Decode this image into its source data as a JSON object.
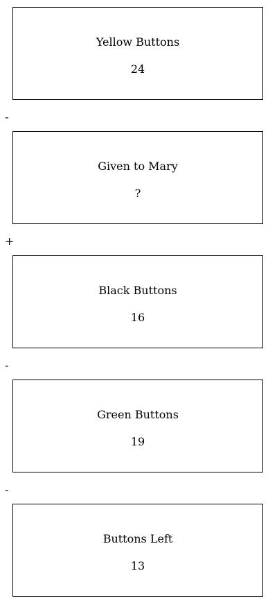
{
  "steps": [
    {
      "label": "Yellow Buttons",
      "value": "24"
    },
    {
      "label": "Given to Mary",
      "value": "?"
    },
    {
      "label": "Black Buttons",
      "value": "16"
    },
    {
      "label": "Green Buttons",
      "value": "19"
    },
    {
      "label": "Buttons Left",
      "value": "13"
    }
  ],
  "operators": [
    "-",
    "+",
    "-",
    "-"
  ]
}
